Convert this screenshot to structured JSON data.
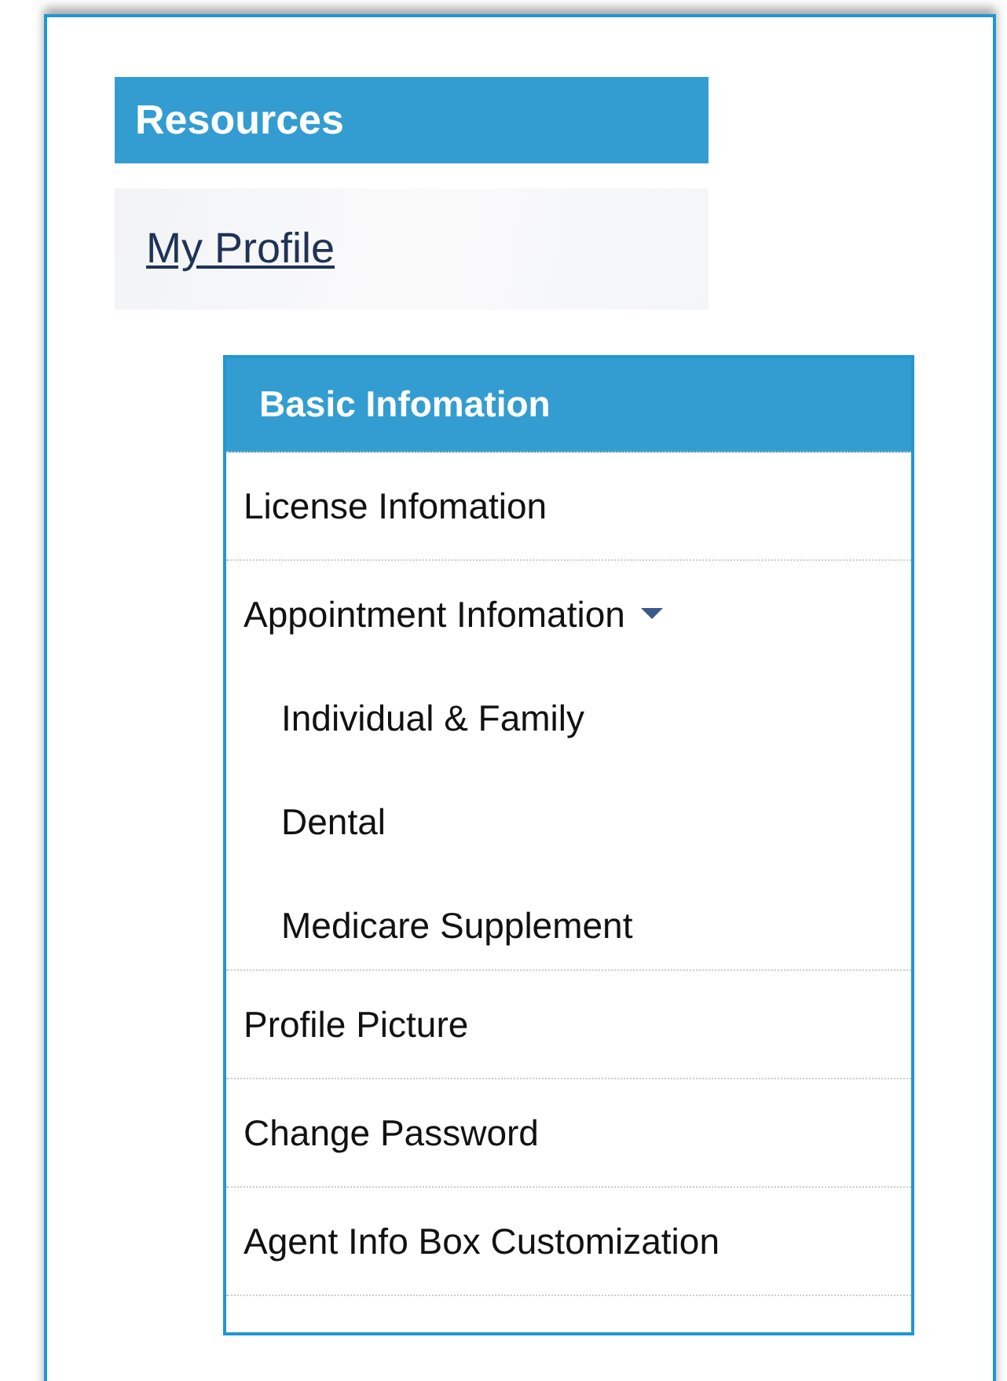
{
  "resources": {
    "title": "Resources",
    "link": "My Profile"
  },
  "menu": {
    "title": "Basic Infomation",
    "items": [
      {
        "label": "License Infomation"
      },
      {
        "label": "Appointment Infomation",
        "expanded": true,
        "children": [
          {
            "label": "Individual & Family"
          },
          {
            "label": "Dental"
          },
          {
            "label": "Medicare Supplement"
          }
        ]
      },
      {
        "label": "Profile Picture"
      },
      {
        "label": "Change Password"
      },
      {
        "label": "Agent Info Box Customization"
      }
    ]
  }
}
